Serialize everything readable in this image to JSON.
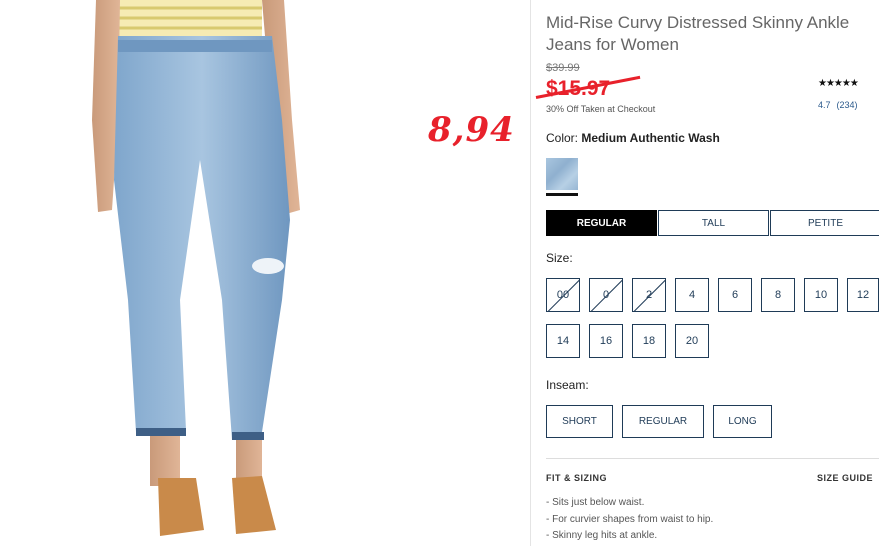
{
  "product": {
    "title": "Mid-Rise Curvy Distressed Skinny Ankle Jeans for Women",
    "price_original": "$39.99",
    "price_current": "$15.97",
    "promo": "30% Off Taken at Checkout",
    "annotation_price": "8,94",
    "rating_stars": "★★★★★",
    "rating_value": "4.7",
    "rating_count": "(234)"
  },
  "color": {
    "label": "Color:",
    "value": "Medium Authentic Wash"
  },
  "fit_tabs": [
    {
      "label": "REGULAR",
      "active": true
    },
    {
      "label": "TALL",
      "active": false
    },
    {
      "label": "PETITE",
      "active": false
    }
  ],
  "size": {
    "label": "Size:",
    "options": [
      {
        "label": "00",
        "available": false
      },
      {
        "label": "0",
        "available": false
      },
      {
        "label": "2",
        "available": false
      },
      {
        "label": "4",
        "available": true
      },
      {
        "label": "6",
        "available": true
      },
      {
        "label": "8",
        "available": true
      },
      {
        "label": "10",
        "available": true
      },
      {
        "label": "12",
        "available": true
      },
      {
        "label": "14",
        "available": true
      },
      {
        "label": "16",
        "available": true
      },
      {
        "label": "18",
        "available": true
      },
      {
        "label": "20",
        "available": true
      }
    ]
  },
  "inseam": {
    "label": "Inseam:",
    "options": [
      "SHORT",
      "REGULAR",
      "LONG"
    ]
  },
  "fit_sizing": {
    "heading": "FIT & SIZING",
    "size_guide": "SIZE GUIDE",
    "bullets": [
      "Sits just below waist.",
      "For curvier shapes from waist to hip.",
      "Skinny leg hits at ankle."
    ]
  },
  "colors": {
    "sale_red": "#e8212b",
    "navy": "#1f3b57",
    "denim": "#8fb0cf"
  }
}
